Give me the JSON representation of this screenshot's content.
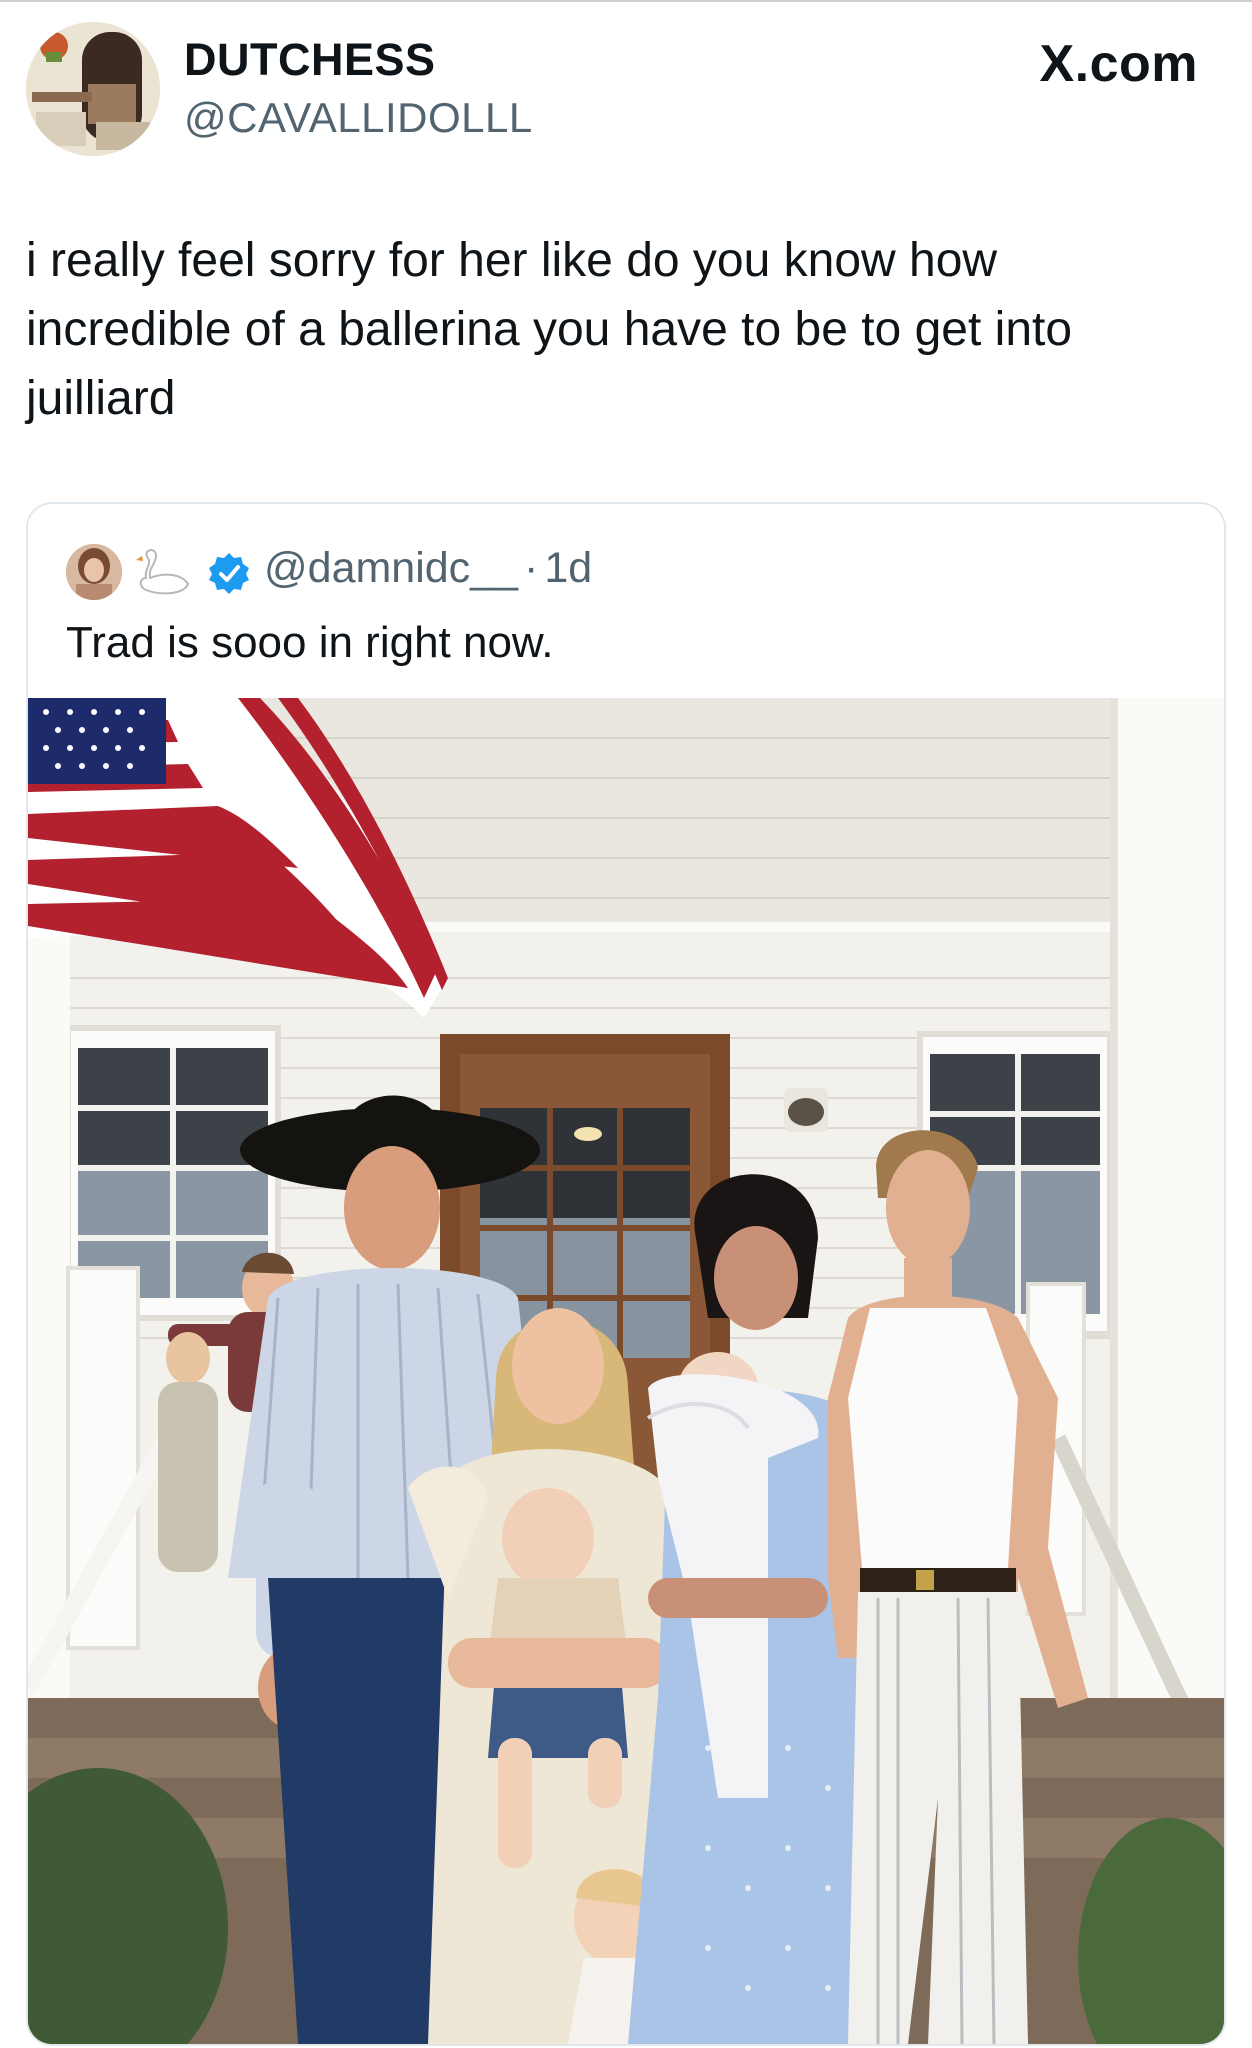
{
  "header": {
    "display_name": "DUTCHESS",
    "handle": "@CAVALLIDOLLL",
    "site_logo": "X.com"
  },
  "tweet": {
    "text": "i really feel sorry for her like do you know how incredible of a ballerina you have to be to get into juilliard"
  },
  "quoted_tweet": {
    "handle": "@damnidc__",
    "separator": "·",
    "time": "1d",
    "text": "Trad is sooo in right now.",
    "icons": [
      "avatar",
      "swan-emoji-icon",
      "verified-badge-icon"
    ]
  },
  "photo": {
    "description_icon": "family-on-porch-photo",
    "colors": {
      "siding": "#f2f1ec",
      "porch_ceiling": "#e9e7df",
      "door": "#7a4a2a",
      "dress_blue": "#a9c4e6",
      "flag_red": "#b3202e",
      "flag_blue": "#1e2b6b"
    }
  }
}
